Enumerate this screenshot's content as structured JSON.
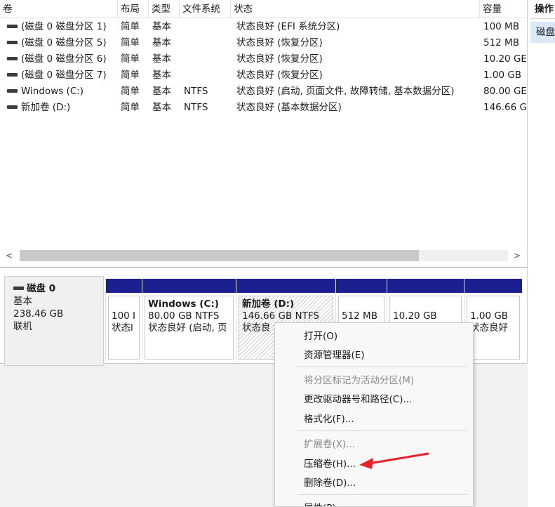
{
  "volume_list": {
    "columns": [
      "卷",
      "布局",
      "类型",
      "文件系统",
      "状态",
      "容量"
    ],
    "rows": [
      {
        "volume": "(磁盘 0 磁盘分区 1)",
        "layout": "简单",
        "type": "基本",
        "fs": "",
        "status": "状态良好 (EFI 系统分区)",
        "capacity": "100 MB"
      },
      {
        "volume": "(磁盘 0 磁盘分区 5)",
        "layout": "简单",
        "type": "基本",
        "fs": "",
        "status": "状态良好 (恢复分区)",
        "capacity": "512 MB"
      },
      {
        "volume": "(磁盘 0 磁盘分区 6)",
        "layout": "简单",
        "type": "基本",
        "fs": "",
        "status": "状态良好 (恢复分区)",
        "capacity": "10.20 GE"
      },
      {
        "volume": "(磁盘 0 磁盘分区 7)",
        "layout": "简单",
        "type": "基本",
        "fs": "",
        "status": "状态良好 (恢复分区)",
        "capacity": "1.00 GB"
      },
      {
        "volume": "Windows (C:)",
        "layout": "简单",
        "type": "基本",
        "fs": "NTFS",
        "status": "状态良好 (启动, 页面文件, 故障转储, 基本数据分区)",
        "capacity": "80.00 GE"
      },
      {
        "volume": "新加卷 (D:)",
        "layout": "简单",
        "type": "基本",
        "fs": "NTFS",
        "status": "状态良好 (基本数据分区)",
        "capacity": "146.66 G"
      }
    ],
    "scroll_left": "<",
    "scroll_right": ">"
  },
  "actions": {
    "header": "操作",
    "item": "磁盘"
  },
  "disk": {
    "name": "磁盘 0",
    "type": "基本",
    "size": "238.46 GB",
    "status": "联机",
    "partitions": [
      {
        "line1": "",
        "line2": "100 I",
        "line3": "状态l"
      },
      {
        "line1": "Windows  (C:)",
        "line2": "80.00 GB NTFS",
        "line3": "状态良好 (启动, 页"
      },
      {
        "line1": "新加卷  (D:)",
        "line2": "146.66 GB NTFS",
        "line3": "状态良"
      },
      {
        "line1": "",
        "line2": "512 MB",
        "line3": ""
      },
      {
        "line1": "",
        "line2": "10.20 GB",
        "line3": ""
      },
      {
        "line1": "",
        "line2": "1.00 GB",
        "line3": "状态良好"
      }
    ]
  },
  "context_menu": {
    "items": [
      {
        "label": "打开(O)",
        "disabled": false
      },
      {
        "label": "资源管理器(E)",
        "disabled": false
      },
      {
        "label": "将分区标记为活动分区(M)",
        "disabled": true
      },
      {
        "label": "更改驱动器号和路径(C)...",
        "disabled": false
      },
      {
        "label": "格式化(F)...",
        "disabled": false
      },
      {
        "label": "扩展卷(X)...",
        "disabled": true
      },
      {
        "label": "压缩卷(H)...",
        "disabled": false
      },
      {
        "label": "删除卷(D)...",
        "disabled": false
      },
      {
        "label": "属性(P)",
        "disabled": false
      }
    ]
  },
  "colors": {
    "partition_header": "#1b1f8f",
    "annotation_arrow": "#e8202a",
    "selection_highlight": "#dbe8f7"
  }
}
